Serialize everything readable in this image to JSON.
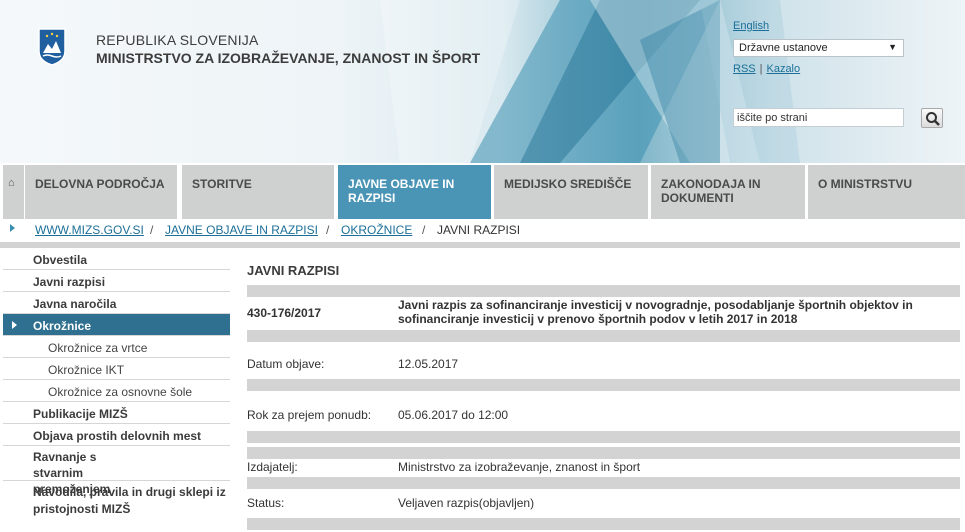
{
  "header": {
    "org_line1": "REPUBLIKA SLOVENIJA",
    "org_line2": "MINISTRSTVO ZA IZOBRAŽEVANJE, ZNANOST IN ŠPORT",
    "language_link": "English",
    "institutions_select": "Državne ustanove",
    "rss_link": "RSS",
    "index_link": "Kazalo",
    "search_value": "iščite po strani",
    "crest_icon": "slovenian-coat-of-arms",
    "search_icon": "magnifier"
  },
  "nav": {
    "home_icon": "home-icon",
    "items": [
      {
        "label": "DELOVNA PODROČJA"
      },
      {
        "label": "STORITVE"
      },
      {
        "label": "JAVNE OBJAVE IN RAZPISI"
      },
      {
        "label": "MEDIJSKO SREDIŠČE"
      },
      {
        "label": "ZAKONODAJA IN DOKUMENTI"
      },
      {
        "label": "O MINISTRSTVU"
      }
    ],
    "active_index": 2,
    "active_color": "#4a95b6"
  },
  "breadcrumb": {
    "items": [
      "WWW.MIZS.GOV.SI",
      "JAVNE OBJAVE IN RAZPISI",
      "OKROŽNICE"
    ],
    "current": "JAVNI RAZPISI",
    "separator": "/"
  },
  "sidebar": {
    "items": [
      {
        "label": "Obvestila"
      },
      {
        "label": "Javni razpisi"
      },
      {
        "label": "Javna naročila"
      },
      {
        "label": "Okrožnice",
        "active": true
      },
      {
        "label": "Okrožnice za vrtce",
        "sub": true
      },
      {
        "label": "Okrožnice IKT",
        "sub": true
      },
      {
        "label": "Okrožnice za osnovne šole",
        "sub": true
      },
      {
        "label": "Publikacije MIZŠ"
      },
      {
        "label": "Objava prostih delovnih mest"
      },
      {
        "label": "Ravnanje s stvarnim premoženjem"
      },
      {
        "label": "Navodila, pravila in drugi sklepi iz pristojnosti MIZŠ"
      }
    ],
    "active_color": "#2f6f8f"
  },
  "main": {
    "title": "JAVNI RAZPISI",
    "number": "430-176/2017",
    "description": "Javni razpis za sofinanciranje investicij v novogradnje, posodabljanje športnih objektov in sofinanciranje investicij v prenovo športnih podov v letih 2017 in 2018",
    "fields": [
      {
        "label": "Datum objave:",
        "value": "12.05.2017"
      },
      {
        "label": "Rok za prejem ponudb:",
        "value": "05.06.2017 do 12:00"
      },
      {
        "label": "Izdajatelj:",
        "value": "Ministrstvo za izobraževanje, znanost in šport"
      },
      {
        "label": "Status:",
        "value": "Veljaven razpis(objavljen)"
      }
    ]
  }
}
